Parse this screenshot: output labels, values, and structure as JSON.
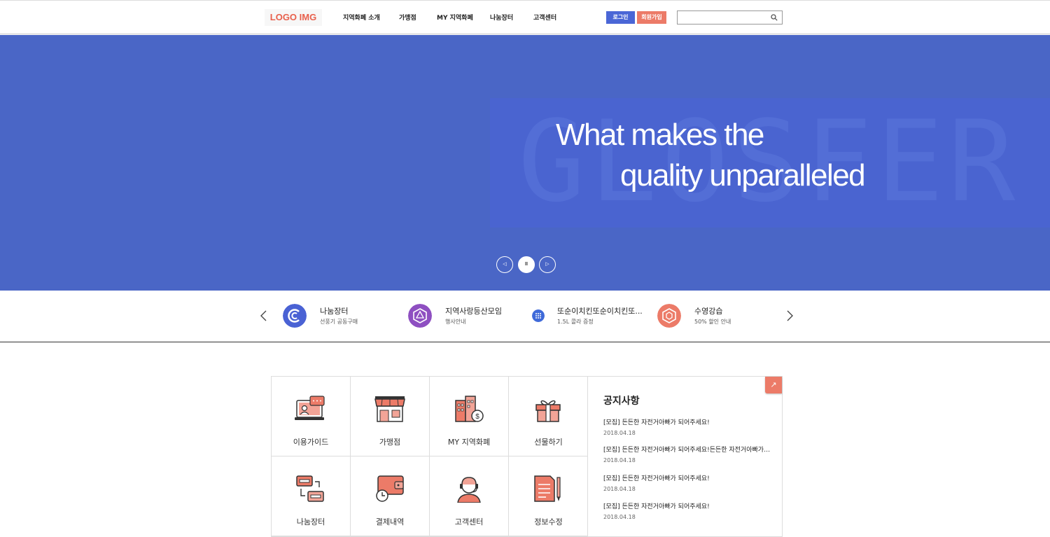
{
  "header": {
    "logo": "LOGO IMG",
    "nav": [
      "지역화폐 소개",
      "가맹점",
      "MY 지역화폐",
      "나눔장터",
      "고객센터"
    ],
    "login": "로그인",
    "join": "회원가입",
    "search_placeholder": ""
  },
  "hero": {
    "line1": "What makes the",
    "line2": "quality unparalleled",
    "bg_text": "GLOSFER DEMO",
    "controls": {
      "prev": "◁",
      "pause": "II",
      "next": "▷"
    }
  },
  "ticker": {
    "items": [
      {
        "title": "나눔장터",
        "sub": "선풍기 공동구매",
        "color": "#4a62d4"
      },
      {
        "title": "지역사랑등산모임",
        "sub": "행사안내",
        "color": "#8e4fc1"
      },
      {
        "title": "또순이치킨또순이치킨또...",
        "sub": "1.5L 콜라 증정",
        "color": "#3f6ad9"
      },
      {
        "title": "수영강습",
        "sub": "50% 할인 안내",
        "color": "#ec7b68"
      }
    ]
  },
  "menu": {
    "items": [
      "이용가이드",
      "가맹점",
      "MY 지역화폐",
      "선물하기",
      "나눔장터",
      "결제내역",
      "고객센터",
      "정보수정"
    ]
  },
  "notice": {
    "title": "공지사항",
    "more": "↗",
    "items": [
      {
        "text": "[모집] 든든한 자전거아빠가 되어주세요!",
        "date": "2018.04.18"
      },
      {
        "text": "[모집] 든든한 자전거아빠가 되어주세요!든든한 자전거아빠가 되...",
        "date": "2018.04.18"
      },
      {
        "text": "[모집] 든든한 자전거아빠가 되어주세요!",
        "date": "2018.04.18"
      },
      {
        "text": "[모집] 든든한 자전거아빠가 되어주세요!",
        "date": "2018.04.18"
      }
    ]
  },
  "colors": {
    "primary": "#4a66c6",
    "accent": "#ec7b68",
    "login": "#4a66d6"
  }
}
